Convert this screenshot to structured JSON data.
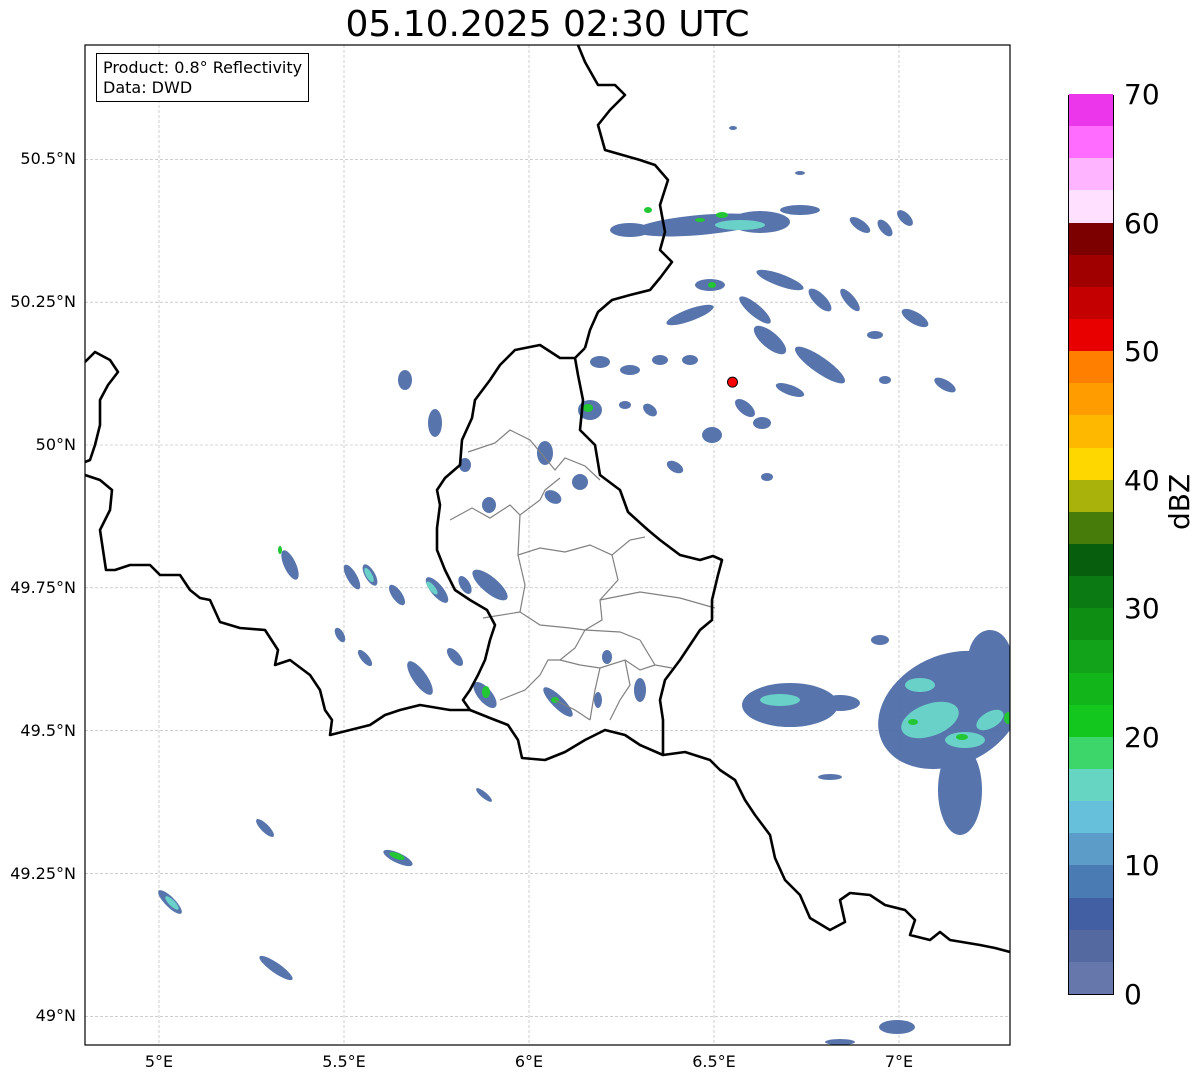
{
  "title": "05.10.2025 02:30 UTC",
  "info": {
    "product": "Product: 0.8° Reflectivity",
    "source": "Data: DWD"
  },
  "map": {
    "lon_range": [
      4.8,
      7.3
    ],
    "lat_range": [
      48.95,
      50.7
    ],
    "lat_ticks": [
      {
        "v": 50.5,
        "label": "50.5°N"
      },
      {
        "v": 50.25,
        "label": "50.25°N"
      },
      {
        "v": 50.0,
        "label": "50°N"
      },
      {
        "v": 49.75,
        "label": "49.75°N"
      },
      {
        "v": 49.5,
        "label": "49.5°N"
      },
      {
        "v": 49.25,
        "label": "49.25°N"
      },
      {
        "v": 49.0,
        "label": "49°N"
      }
    ],
    "lon_ticks": [
      {
        "v": 5.0,
        "label": "5°E"
      },
      {
        "v": 5.5,
        "label": "5.5°E"
      },
      {
        "v": 6.0,
        "label": "6°E"
      },
      {
        "v": 6.5,
        "label": "6.5°E"
      },
      {
        "v": 7.0,
        "label": "7°E"
      }
    ],
    "marker": {
      "lon": 6.55,
      "lat": 50.11,
      "color": "#ff0000"
    }
  },
  "colorbar": {
    "label": "dBZ",
    "min": 0,
    "max": 70,
    "tick_labels": [
      "0",
      "10",
      "20",
      "30",
      "40",
      "50",
      "60",
      "70"
    ],
    "colors": [
      "#6577ab",
      "#5469a0",
      "#425fa3",
      "#4a7bb3",
      "#5b9dc8",
      "#66c0dc",
      "#66d6c2",
      "#3dd66b",
      "#13c71e",
      "#12b51a",
      "#12a31a",
      "#0e8f14",
      "#0b7a12",
      "#075e0d",
      "#477b0a",
      "#a9b20a",
      "#ffd700",
      "#ffb800",
      "#ff9c00",
      "#ff7f00",
      "#e80000",
      "#c40000",
      "#a00000",
      "#7d0000",
      "#ffe0ff",
      "#ffb4ff",
      "#ff6cff",
      "#ec36ec"
    ]
  }
}
